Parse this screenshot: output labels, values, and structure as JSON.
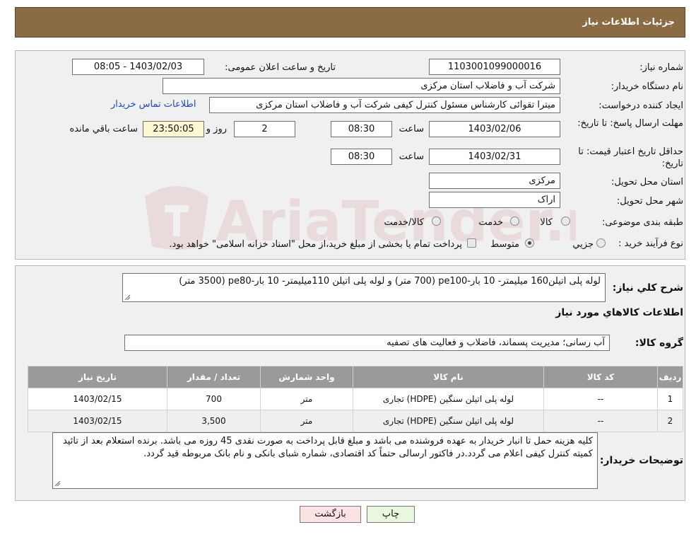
{
  "header": {
    "title": "جزئیات اطلاعات نیاز"
  },
  "form": {
    "need_number": {
      "label": "شماره نیاز:",
      "value": "1103001099000016"
    },
    "announce_datetime": {
      "label": "تاریخ و ساعت اعلان عمومی:",
      "value": "1403/02/03 - 08:05"
    },
    "buyer_org": {
      "label": "نام دستگاه خریدار:",
      "value": "شرکت آب و فاضلاب استان مرکزی"
    },
    "requester": {
      "label": "ایجاد کننده درخواست:",
      "value": "میترا تقوائی کارشناس مسئول کنترل کیفی شرکت آب و فاضلاب استان مرکزی",
      "contact_link": "اطلاعات تماس خریدار"
    },
    "deadline": {
      "label": "مهلت ارسال پاسخ: تا تاریخ:",
      "date": "1403/02/06",
      "time_label": "ساعت",
      "time": "08:30",
      "days": "2",
      "days_label": "روز و",
      "remaining": "23:50:05",
      "remaining_label": "ساعت باقي مانده"
    },
    "price_validity": {
      "label": "حداقل تاریخ اعتبار قیمت: تا تاریخ:",
      "date": "1403/02/31",
      "time_label": "ساعت",
      "time": "08:30"
    },
    "delivery_province": {
      "label": "استان محل تحویل:",
      "value": "مرکزی"
    },
    "delivery_city": {
      "label": "شهر محل تحویل:",
      "value": "اراک"
    },
    "category": {
      "label": "طبقه بندی موضوعی:",
      "options": [
        "کالا",
        "خدمت",
        "کالا/خدمت"
      ],
      "selected": "کالا"
    },
    "process_type": {
      "label": "نوع فرآیند خرید :",
      "options": [
        "جزیي",
        "متوسط"
      ],
      "selected": "متوسط",
      "note": "پرداخت تمام یا بخشی از مبلغ خرید،از محل \"اسناد خزانه اسلامی\" خواهد بود."
    }
  },
  "summary": {
    "label": "شرح کلي نياز:",
    "value": "لوله پلی اتیلن160 میلیمتر- 10 بار-pe100 (700 متر) و لوله پلی اتیلن 110میلیمتر- 10 بار-pe80  (3500 متر)"
  },
  "goods_info_title": "اطلاعات کالاهاي مورد نياز",
  "goods_group": {
    "label": "گروه کالا:",
    "value": "آب رسانی؛ مدیریت پسماند، فاضلاب و فعالیت های تصفیه"
  },
  "table": {
    "headers": [
      "رديف",
      "کد کالا",
      "نام کالا",
      "واحد شمارش",
      "تعداد / مقدار",
      "تاریخ نیاز"
    ],
    "rows": [
      [
        "1",
        "--",
        "لوله پلی اتیلن سنگین (HDPE) تجاری",
        "متر",
        "700",
        "1403/02/15"
      ],
      [
        "2",
        "--",
        "لوله پلی اتیلن سنگین (HDPE) تجاری",
        "متر",
        "3,500",
        "1403/02/15"
      ]
    ]
  },
  "buyer_notes": {
    "label": "توضیحات خریدار:",
    "value": "کلیه هزینه حمل تا انبار خریدار به عهده فروشنده می باشد و مبلغ قابل پرداخت به صورت نقدی 45 روزه می باشد. برنده استعلام بعد از تائید کمیته کنترل کیفی اعلام می گردد.در فاکتور ارسالی حتماً کد اقتصادی، شماره شبای بانکی و نام بانک مربوطه قید گردد."
  },
  "buttons": {
    "print": "چاپ",
    "back": "بازگشت"
  },
  "watermark": {
    "text": "AriaTender.neT",
    "color": "#b52a2a"
  }
}
